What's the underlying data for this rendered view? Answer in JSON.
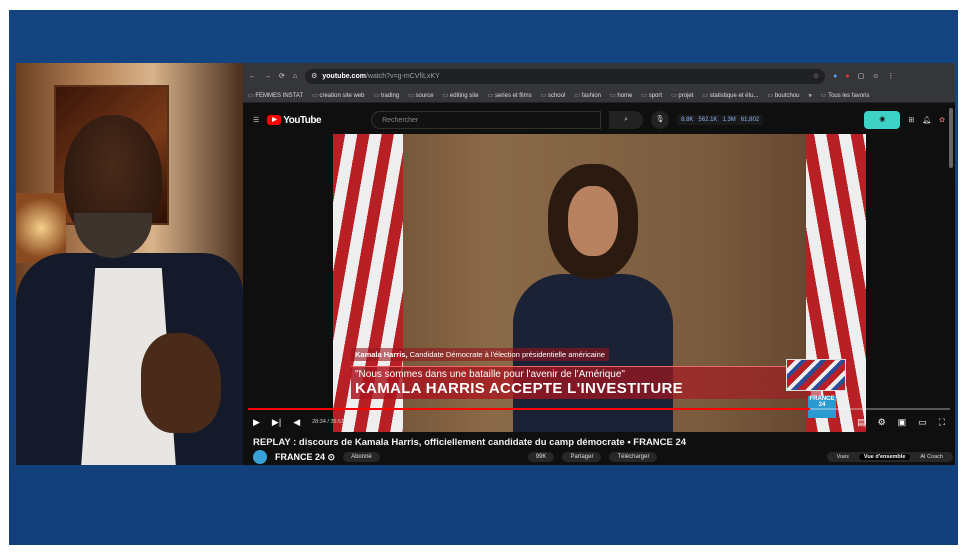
{
  "browser": {
    "url_host": "youtube.com",
    "url_path": "/watch?v=g-mCVfiLxKY",
    "bookmarks": [
      "FEMMES INSTAT",
      "creation site web",
      "trading",
      "source",
      "editing site",
      "series et films",
      "school",
      "fashion",
      "home",
      "sport",
      "projet",
      "statistique et étu...",
      "boutchou",
      "»",
      "Tous les favoris"
    ]
  },
  "youtube": {
    "logo": "YouTube",
    "search_placeholder": "Rechercher",
    "stats": [
      "8.8K",
      "562.1K",
      "1.3M",
      "61,802"
    ],
    "video": {
      "lower_name": "Kamala Harris,",
      "lower_role": "Candidate Démocrate à l'élection présidentielle américaine",
      "quote": "\"Nous sommes dans une bataille pour l'avenir de l'Amérique\"",
      "headline": "KAMALA HARRIS ACCEPTE L'INVESTITURE",
      "channel_bug": "FRANCE 24",
      "time": "28:34 / 35:51",
      "progress": 0.8
    },
    "title": "REPLAY : discours de Kamala Harris, officiellement candidate du camp démocrate • FRANCE 24",
    "channel": "FRANCE 24 ⊙",
    "buttons": [
      "Abonné",
      "99K",
      "Partager",
      "Télécharger"
    ],
    "tabs": [
      "Vues",
      "Vue d'ensemble",
      "AI Coach"
    ]
  }
}
